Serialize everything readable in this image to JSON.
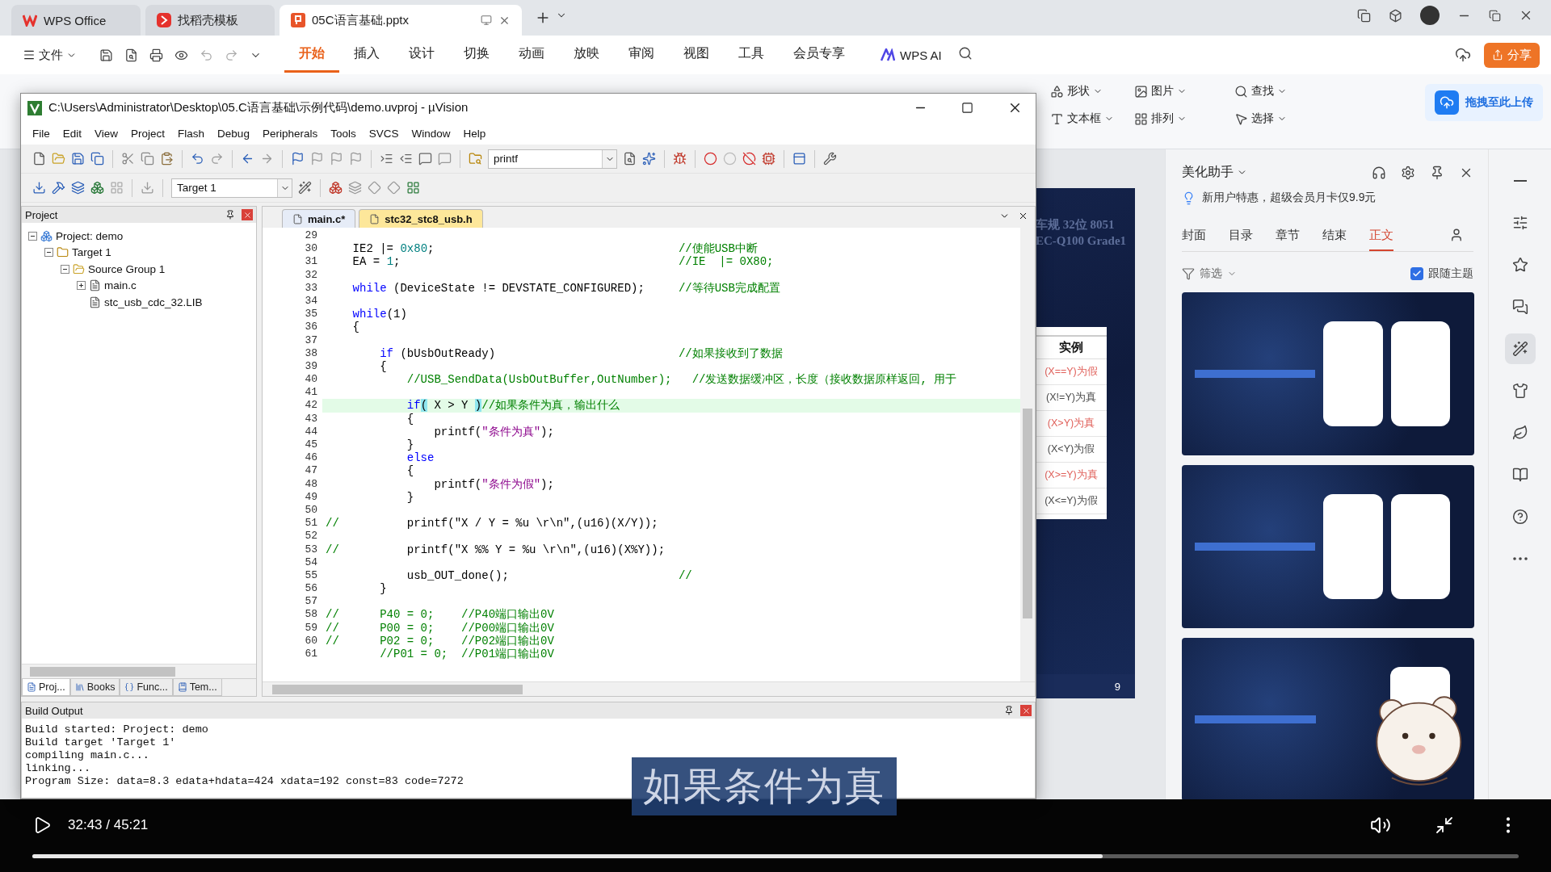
{
  "wps": {
    "tabs": [
      {
        "label": "WPS Office",
        "kind": "home",
        "selected": false
      },
      {
        "label": "找稻壳模板",
        "kind": "template",
        "selected": false
      },
      {
        "label": "05C语言基础.pptx",
        "kind": "document",
        "selected": true
      }
    ],
    "file_menu": "文件",
    "menu_tabs": [
      {
        "label": "开始",
        "selected": true
      },
      {
        "label": "插入",
        "selected": false
      },
      {
        "label": "设计",
        "selected": false
      },
      {
        "label": "切换",
        "selected": false
      },
      {
        "label": "动画",
        "selected": false
      },
      {
        "label": "放映",
        "selected": false
      },
      {
        "label": "审阅",
        "selected": false
      },
      {
        "label": "视图",
        "selected": false
      },
      {
        "label": "工具",
        "selected": false
      },
      {
        "label": "会员专享",
        "selected": false
      }
    ],
    "ai_label": "WPS AI",
    "share_button": "分享",
    "ribbon": [
      {
        "label": "形状",
        "kind": "shape"
      },
      {
        "label": "图片",
        "kind": "picture"
      },
      {
        "label": "查找",
        "kind": "find"
      },
      {
        "label": "文本框",
        "kind": "textbox"
      },
      {
        "label": "排列",
        "kind": "arrange"
      },
      {
        "label": "选择",
        "kind": "select"
      }
    ],
    "upload_button": "拖拽至此上传"
  },
  "slide": {
    "header_lines": [
      "车规 32位 8051",
      "EC-Q100 Grade1"
    ],
    "table_heading": "实例",
    "table_rows": [
      {
        "text": "(X==Y)为假",
        "color": "#e0605a"
      },
      {
        "text": "(X!=Y)为真",
        "color": "#4a4a4a"
      },
      {
        "text": "(X>Y)为真",
        "color": "#e0605a"
      },
      {
        "text": "(X<Y)为假",
        "color": "#4a4a4a"
      },
      {
        "text": "(X>=Y)为真",
        "color": "#e0605a"
      },
      {
        "text": "(X<=Y)为假",
        "color": "#4a4a4a"
      }
    ],
    "page_number": "9"
  },
  "assistant": {
    "title": "美化助手",
    "promo": "新用户特惠，超级会员月卡仅9.9元",
    "tabs": [
      {
        "label": "封面",
        "selected": false
      },
      {
        "label": "目录",
        "selected": false
      },
      {
        "label": "章节",
        "selected": false
      },
      {
        "label": "结束",
        "selected": false
      },
      {
        "label": "正文",
        "selected": true
      }
    ],
    "filter": "筛选",
    "follow_theme": {
      "label": "跟随主题",
      "checked": true
    }
  },
  "side_rail": [
    {
      "kind": "minimize",
      "selected": false
    },
    {
      "kind": "sliders",
      "selected": false
    },
    {
      "kind": "star",
      "selected": false
    },
    {
      "kind": "chat",
      "selected": false
    },
    {
      "kind": "wand",
      "selected": true
    },
    {
      "kind": "shirt",
      "selected": false
    },
    {
      "kind": "leaf",
      "selected": false
    },
    {
      "kind": "book",
      "selected": false
    },
    {
      "kind": "help",
      "selected": false
    },
    {
      "kind": "more",
      "selected": false
    }
  ],
  "uvision": {
    "title": "C:\\Users\\Administrator\\Desktop\\05.C语言基础\\示例代码\\demo.uvproj - µVision",
    "menu": [
      "File",
      "Edit",
      "View",
      "Project",
      "Flash",
      "Debug",
      "Peripherals",
      "Tools",
      "SVCS",
      "Window",
      "Help"
    ],
    "find_combo": "printf",
    "target_combo": "Target 1",
    "project_panel": {
      "title": "Project",
      "tree": [
        {
          "label": "Project: demo",
          "kind": "project",
          "expanded": true,
          "children": [
            {
              "label": "Target 1",
              "kind": "target",
              "expanded": true,
              "children": [
                {
                  "label": "Source Group 1",
                  "kind": "group",
                  "expanded": true,
                  "children": [
                    {
                      "label": "main.c",
                      "kind": "file",
                      "expanded": false
                    },
                    {
                      "label": "stc_usb_cdc_32.LIB",
                      "kind": "file"
                    }
                  ]
                }
              ]
            }
          ]
        }
      ],
      "tabs": [
        {
          "label": "Proj...",
          "kind": "project",
          "selected": true
        },
        {
          "label": "Books",
          "kind": "books",
          "selected": false
        },
        {
          "label": "Func...",
          "kind": "functions",
          "selected": false
        },
        {
          "label": "Tem...",
          "kind": "templates",
          "selected": false
        }
      ]
    },
    "editor": {
      "tabs": [
        {
          "label": "main.c*",
          "selected": true
        },
        {
          "label": "stc32_stc8_usb.h",
          "selected": false
        }
      ],
      "lines": [
        {
          "number": "29",
          "current": false
        },
        {
          "number": "30",
          "current": false,
          "segments": [
            {
              "kind": "plain",
              "text": "    IE2 |= "
            },
            {
              "kind": "number",
              "text": "0x80"
            },
            {
              "kind": "plain",
              "text": ";                                    "
            },
            {
              "kind": "comment",
              "text": "//使能USB中断"
            }
          ]
        },
        {
          "number": "31",
          "current": false,
          "segments": [
            {
              "kind": "plain",
              "text": "    EA = "
            },
            {
              "kind": "number",
              "text": "1"
            },
            {
              "kind": "plain",
              "text": ";                                         "
            },
            {
              "kind": "comment",
              "text": "//IE  |= 0X80;"
            }
          ]
        },
        {
          "number": "32",
          "current": false
        },
        {
          "number": "33",
          "current": false,
          "segments": [
            {
              "kind": "keyword",
              "text": "    while"
            },
            {
              "kind": "plain",
              "text": " (DeviceState != DEVSTATE_CONFIGURED);     "
            },
            {
              "kind": "comment",
              "text": "//等待USB完成配置"
            }
          ]
        },
        {
          "number": "34",
          "current": false
        },
        {
          "number": "35",
          "current": false,
          "segments": [
            {
              "kind": "keyword",
              "text": "    while"
            },
            {
              "kind": "plain",
              "text": "(1)"
            }
          ]
        },
        {
          "number": "36",
          "current": false,
          "segments": [
            {
              "kind": "plain",
              "text": "    {"
            }
          ]
        },
        {
          "number": "37",
          "current": false
        },
        {
          "number": "38",
          "current": false,
          "segments": [
            {
              "kind": "keyword",
              "text": "        if"
            },
            {
              "kind": "plain",
              "text": " (bUsbOutReady)                           "
            },
            {
              "kind": "comment",
              "text": "//如果接收到了数据"
            }
          ]
        },
        {
          "number": "39",
          "current": false,
          "segments": [
            {
              "kind": "plain",
              "text": "        {"
            }
          ]
        },
        {
          "number": "40",
          "current": false,
          "segments": [
            {
              "kind": "comment",
              "text": "            //USB_SendData(UsbOutBuffer,OutNumber);   //发送数据缓冲区，长度（接收数据原样返回, 用于"
            }
          ]
        },
        {
          "number": "41",
          "current": false
        },
        {
          "number": "42",
          "current": true,
          "segments": [
            {
              "kind": "keyword",
              "text": "            if"
            },
            {
              "kind": "match",
              "text": "("
            },
            {
              "kind": "plain",
              "text": " X > Y "
            },
            {
              "kind": "match",
              "text": ")"
            },
            {
              "kind": "comment",
              "text": "//如果条件为真，输出什么"
            }
          ]
        },
        {
          "number": "43",
          "current": false,
          "segments": [
            {
              "kind": "plain",
              "text": "            {"
            }
          ]
        },
        {
          "number": "44",
          "current": false,
          "segments": [
            {
              "kind": "plain",
              "text": "                printf("
            },
            {
              "kind": "string",
              "text": "\"条件为真\""
            },
            {
              "kind": "plain",
              "text": ");"
            }
          ]
        },
        {
          "number": "45",
          "current": false,
          "segments": [
            {
              "kind": "plain",
              "text": "            }"
            }
          ]
        },
        {
          "number": "46",
          "current": false,
          "segments": [
            {
              "kind": "keyword",
              "text": "            else"
            }
          ]
        },
        {
          "number": "47",
          "current": false,
          "segments": [
            {
              "kind": "plain",
              "text": "            {"
            }
          ]
        },
        {
          "number": "48",
          "current": false,
          "segments": [
            {
              "kind": "plain",
              "text": "                printf("
            },
            {
              "kind": "string",
              "text": "\"条件为假\""
            },
            {
              "kind": "plain",
              "text": ");"
            }
          ]
        },
        {
          "number": "49",
          "current": false,
          "segments": [
            {
              "kind": "plain",
              "text": "            }"
            }
          ]
        },
        {
          "number": "50",
          "current": false
        },
        {
          "number": "51",
          "current": false,
          "segments": [
            {
              "kind": "comment",
              "text": "//"
            },
            {
              "kind": "plain",
              "text": "          printf(\"X / Y = %u \\r\\n\",(u16)(X/Y));"
            }
          ]
        },
        {
          "number": "52",
          "current": false
        },
        {
          "number": "53",
          "current": false,
          "segments": [
            {
              "kind": "comment",
              "text": "//"
            },
            {
              "kind": "plain",
              "text": "          printf(\"X %% Y = %u \\r\\n\",(u16)(X%Y));"
            }
          ]
        },
        {
          "number": "54",
          "current": false
        },
        {
          "number": "55",
          "current": false,
          "segments": [
            {
              "kind": "plain",
              "text": "            usb_OUT_done();                         "
            },
            {
              "kind": "comment",
              "text": "//"
            }
          ]
        },
        {
          "number": "56",
          "current": false,
          "segments": [
            {
              "kind": "plain",
              "text": "        }"
            }
          ]
        },
        {
          "number": "57",
          "current": false
        },
        {
          "number": "58",
          "current": false,
          "segments": [
            {
              "kind": "comment",
              "text": "//      P40 = 0;    //P40端口输出0V"
            }
          ]
        },
        {
          "number": "59",
          "current": false,
          "segments": [
            {
              "kind": "comment",
              "text": "//      P00 = 0;    //P00端口输出0V"
            }
          ]
        },
        {
          "number": "60",
          "current": false,
          "segments": [
            {
              "kind": "comment",
              "text": "//      P02 = 0;    //P02端口输出0V"
            }
          ]
        },
        {
          "number": "61",
          "current": false,
          "segments": [
            {
              "kind": "comment",
              "text": "        //P01 = 0;  //P01端口输出0V"
            }
          ]
        }
      ]
    },
    "build_output": {
      "title": "Build Output",
      "lines": [
        "Build started: Project: demo",
        "Build target 'Target 1'",
        "compiling main.c...",
        "linking...",
        "Program Size: data=8.3 edata+hdata=424 xdata=192 const=83 code=7272"
      ]
    }
  },
  "player": {
    "time": "32:43 / 45:21",
    "level": 0.72,
    "subtitle": "如果条件为真"
  }
}
